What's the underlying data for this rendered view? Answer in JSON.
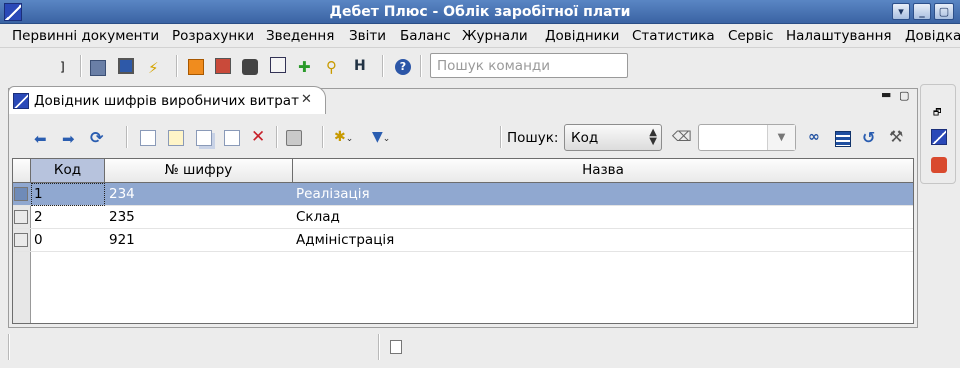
{
  "window": {
    "title": "Дебет Плюс - Облік заробітної плати"
  },
  "menu": [
    "Первинні документи",
    "Розрахунки",
    "Зведення",
    "Звіти",
    "Баланс",
    "Журнали",
    "Довідники",
    "Статистика",
    "Сервіс",
    "Налаштування",
    "Довідка"
  ],
  "toolbar": {
    "command_search_placeholder": "Пошук команди",
    "icons": [
      "toolbar-doc-icon",
      "toolbar-monitor-icon",
      "toolbar-lightning-icon",
      "toolbar-orange-icon",
      "toolbar-card-icon",
      "toolbar-camera-icon",
      "toolbar-calendar-icon",
      "toolbar-add-user-icon",
      "toolbar-search-icon",
      "toolbar-tools-icon",
      "help-icon"
    ]
  },
  "editor": {
    "tab_title": "Довідник шифрів виробничих витрат",
    "search_label": "Пошук:",
    "search_field": "Код"
  },
  "table": {
    "columns": [
      "Код",
      "№ шифру",
      "Назва"
    ],
    "rows": [
      {
        "code": "1",
        "number": "234",
        "name": "Реалізація"
      },
      {
        "code": "2",
        "number": "235",
        "name": "Склад"
      },
      {
        "code": "0",
        "number": "921",
        "name": "Адміністрація"
      }
    ]
  },
  "colors": {
    "titlebar": "#3a63a3",
    "selection": "#90a8d0",
    "header_selected": "#b7c3dd"
  }
}
